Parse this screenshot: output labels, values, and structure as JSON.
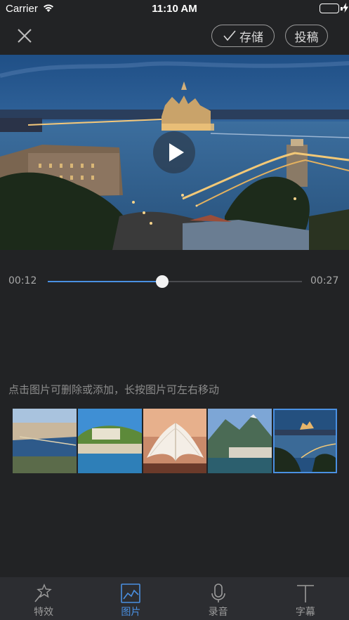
{
  "status_bar": {
    "carrier": "Carrier",
    "time": "11:10 AM",
    "battery_level": 1.0
  },
  "nav": {
    "close_icon": "close-icon",
    "save_label": "存储",
    "post_label": "投稿"
  },
  "video": {
    "scene": "night-city-river-bridge",
    "play_icon": "play-icon"
  },
  "progress": {
    "current": "00:12",
    "total": "00:27",
    "value": 0.45
  },
  "hint": "点击图片可删除或添加，长按图片可左右移动",
  "thumbnails": [
    {
      "scene": "city-river-aerial",
      "selected": false
    },
    {
      "scene": "hill-castle-town",
      "selected": false
    },
    {
      "scene": "open-book",
      "selected": false
    },
    {
      "scene": "alpine-lake-village",
      "selected": false
    },
    {
      "scene": "night-city-river",
      "selected": true
    }
  ],
  "tabs": [
    {
      "label": "特效",
      "icon": "magic-wand-icon",
      "active": false
    },
    {
      "label": "图片",
      "icon": "image-icon",
      "active": true
    },
    {
      "label": "录音",
      "icon": "microphone-icon",
      "active": false
    },
    {
      "label": "字幕",
      "icon": "text-icon",
      "active": false
    }
  ],
  "colors": {
    "accent": "#4a90e2",
    "background": "#222325",
    "tab_bar": "#2c2d31",
    "battery": "#4cd964"
  }
}
